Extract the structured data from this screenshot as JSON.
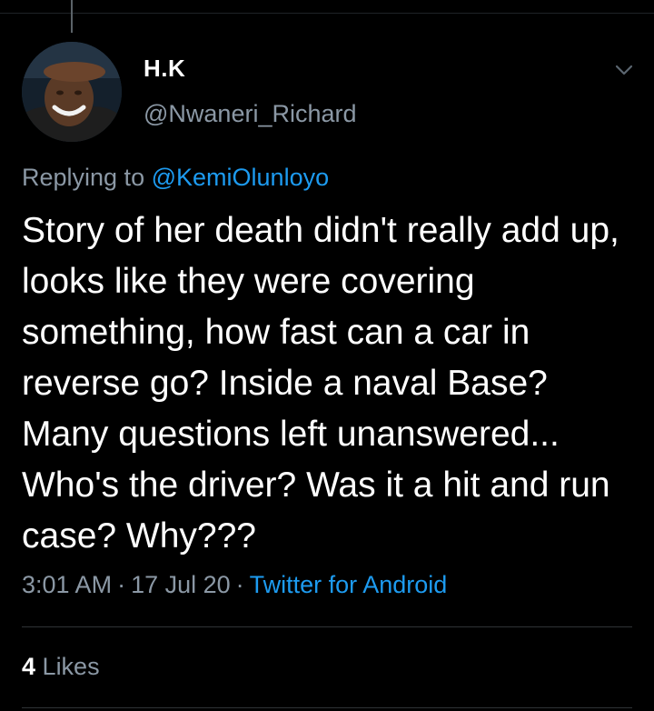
{
  "tweet": {
    "author": {
      "display_name": "H.K",
      "handle": "@Nwaneri_Richard"
    },
    "reply_prefix": "Replying to",
    "reply_to": "@KemiOlunloyo",
    "text": "Story of her death didn't really add up, looks like they were covering something, how fast can a car in reverse go? Inside a naval Base? Many questions left unanswered... Who's the driver? Was it a hit and run case? Why???",
    "time": "3:01 AM",
    "date": "17 Jul 20",
    "separator": "·",
    "source": "Twitter for Android",
    "likes_count": "4",
    "likes_label": "Likes"
  },
  "icons": {
    "menu": "chevron-down-icon"
  },
  "colors": {
    "background": "#000000",
    "text_primary": "#ffffff",
    "text_secondary": "#8b98a5",
    "accent": "#1d9bf0",
    "divider": "#2f3336"
  }
}
